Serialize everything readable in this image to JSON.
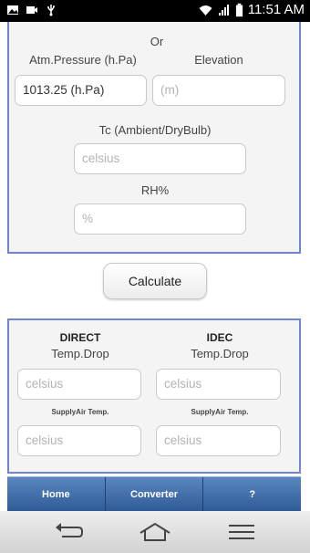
{
  "status_bar": {
    "time": "11:51 AM",
    "left_icons": [
      "image-icon",
      "video-icon",
      "usb-icon"
    ],
    "right_icons": [
      "wifi-icon",
      "signal-icon",
      "battery-icon"
    ]
  },
  "form": {
    "or_label": "Or",
    "pressure_label": "Atm.Pressure (h.Pa)",
    "elevation_label": "Elevation",
    "pressure_value": "1013.25 (h.Pa)",
    "elevation_placeholder": "(m)",
    "temp_label": "Tc (Ambient/DryBulb)",
    "temp_placeholder": "celsius",
    "rh_label": "RH%",
    "rh_placeholder": "%"
  },
  "calculate_label": "Calculate",
  "results": {
    "direct_title": "DIRECT",
    "direct_subtitle": "Temp.Drop",
    "idec_title": "IDEC",
    "idec_subtitle": "Temp.Drop",
    "supply_label_left": "SupplyAir Temp.",
    "supply_label_right": "SupplyAir Temp.",
    "direct_drop_placeholder": "celsius",
    "idec_drop_placeholder": "celsius",
    "direct_supply_placeholder": "celsius",
    "idec_supply_placeholder": "celsius"
  },
  "tabs": {
    "home": "Home",
    "converter": "Converter",
    "help": "?"
  },
  "nav": {
    "icons": [
      "back-icon",
      "home-icon",
      "menu-icon"
    ]
  },
  "colors": {
    "panel_border": "#6d86cf",
    "tab_bar": "#3f6aa8"
  }
}
